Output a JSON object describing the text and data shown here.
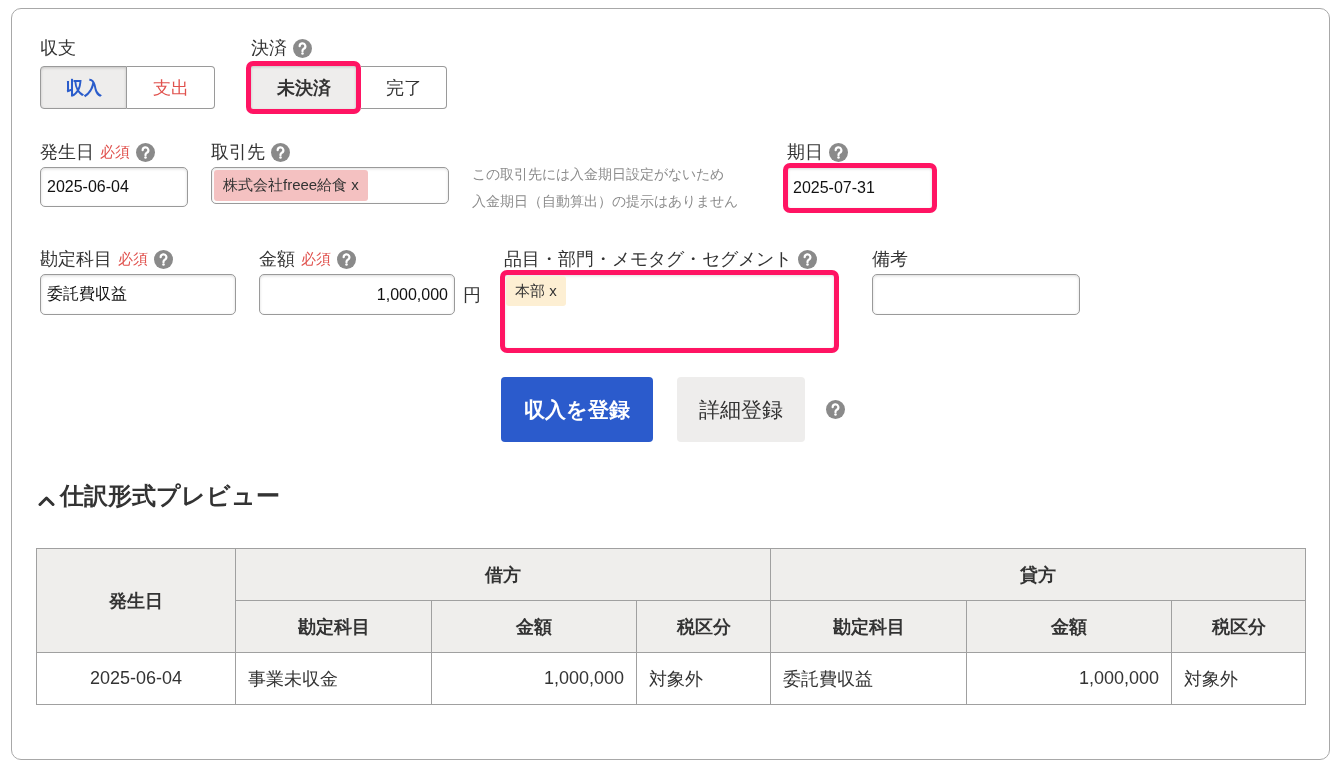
{
  "income_expense": {
    "label": "収支",
    "help": false,
    "options": [
      {
        "label": "収入",
        "kind": "income",
        "selected": true,
        "highlighted": false
      },
      {
        "label": "支出",
        "kind": "expense",
        "selected": false,
        "highlighted": false
      }
    ]
  },
  "settlement": {
    "label": "決済",
    "help": true,
    "options": [
      {
        "label": "未決済",
        "kind": "plain",
        "selected": true,
        "highlighted": true
      },
      {
        "label": "完了",
        "kind": "plain",
        "selected": false,
        "highlighted": false
      }
    ]
  },
  "occurrence_date": {
    "label": "発生日",
    "required_mark": "必須",
    "help": true,
    "value": "2025-06-04",
    "highlighted": false
  },
  "partner": {
    "label": "取引先",
    "help": true,
    "tags": [
      {
        "text": "株式会社freee給食 x"
      }
    ],
    "highlighted": false
  },
  "due_date_note": [
    "この取引先には入金期日設定がないため",
    "入金期日（自動算出）の提示はありません"
  ],
  "due_date": {
    "label": "期日",
    "help": true,
    "value": "2025-07-31",
    "highlighted": true
  },
  "account": {
    "label": "勘定科目",
    "required_mark": "必須",
    "help": true,
    "value": "委託費収益",
    "highlighted": false
  },
  "amount": {
    "label": "金額",
    "required_mark": "必須",
    "help": true,
    "value": "1,000,000",
    "unit": "円",
    "highlighted": false
  },
  "segments": {
    "label": "品目・部門・メモタグ・セグメント",
    "help": true,
    "tags": [
      {
        "text": "本部 x"
      }
    ],
    "highlighted": true
  },
  "remarks": {
    "label": "備考",
    "help": false,
    "highlighted": false
  },
  "actions": {
    "buttons": [
      {
        "label": "収入を登録",
        "kind": "primary"
      },
      {
        "label": "詳細登録",
        "kind": "secondary"
      }
    ],
    "help": true
  },
  "preview": {
    "title": "仕訳形式プレビュー",
    "expanded": true,
    "table": {
      "date_column": "発生日",
      "groups": [
        {
          "label": "借方",
          "columns": [
            "勘定科目",
            "金額",
            "税区分"
          ]
        },
        {
          "label": "貸方",
          "columns": [
            "勘定科目",
            "金額",
            "税区分"
          ]
        }
      ],
      "rows": [
        {
          "date": "2025-06-04",
          "entries": [
            {
              "cells": [
                "事業未収金",
                "1,000,000",
                "対象外"
              ]
            },
            {
              "cells": [
                "委託費収益",
                "1,000,000",
                "対象外"
              ]
            }
          ]
        }
      ]
    }
  }
}
